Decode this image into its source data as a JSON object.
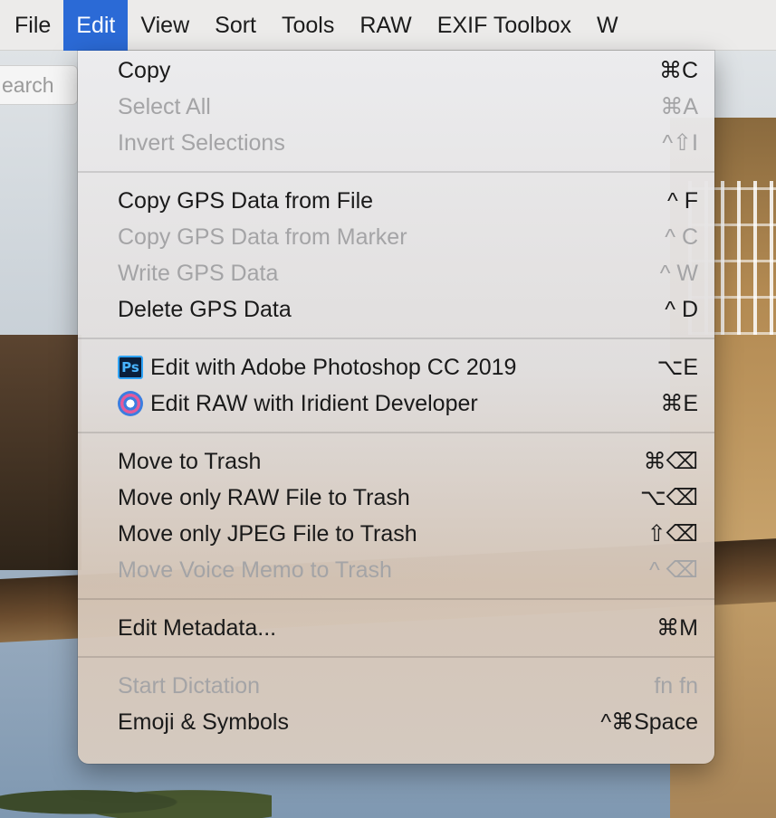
{
  "menubar": {
    "items": [
      {
        "label": "File"
      },
      {
        "label": "Edit",
        "active": true
      },
      {
        "label": "View"
      },
      {
        "label": "Sort"
      },
      {
        "label": "Tools"
      },
      {
        "label": "RAW"
      },
      {
        "label": "EXIF Toolbox"
      },
      {
        "label": "W"
      }
    ]
  },
  "search": {
    "text": "earch"
  },
  "menu": {
    "groups": [
      [
        {
          "label": "Copy",
          "shortcut": "⌘C",
          "enabled": true
        },
        {
          "label": "Select All",
          "shortcut": "⌘A",
          "enabled": false
        },
        {
          "label": "Invert Selections",
          "shortcut": "^⇧I",
          "enabled": false
        }
      ],
      [
        {
          "label": "Copy GPS Data from File",
          "shortcut": "^ F",
          "enabled": true
        },
        {
          "label": "Copy GPS Data from Marker",
          "shortcut": "^ C",
          "enabled": false
        },
        {
          "label": "Write GPS Data",
          "shortcut": "^ W",
          "enabled": false
        },
        {
          "label": "Delete GPS Data",
          "shortcut": "^ D",
          "enabled": true
        }
      ],
      [
        {
          "label": "Edit with Adobe Photoshop CC 2019",
          "shortcut": "⌥E",
          "enabled": true,
          "icon": "photoshop-icon",
          "icon_text": "Ps"
        },
        {
          "label": "Edit RAW with Iridient Developer",
          "shortcut": "⌘E",
          "enabled": true,
          "icon": "iridient-developer-icon"
        }
      ],
      [
        {
          "label": "Move to Trash",
          "shortcut": "⌘⌫",
          "enabled": true
        },
        {
          "label": "Move only RAW File to Trash",
          "shortcut": "⌥⌫",
          "enabled": true
        },
        {
          "label": "Move only JPEG File to Trash",
          "shortcut": "⇧⌫",
          "enabled": true
        },
        {
          "label": "Move Voice Memo to Trash",
          "shortcut": "^ ⌫",
          "enabled": false
        }
      ],
      [
        {
          "label": "Edit Metadata...",
          "shortcut": "⌘M",
          "enabled": true
        }
      ],
      [
        {
          "label": "Start Dictation",
          "shortcut": "fn fn",
          "enabled": false
        },
        {
          "label": "Emoji & Symbols",
          "shortcut": "^⌘Space",
          "enabled": true
        }
      ]
    ]
  },
  "colors": {
    "accent": "#2b6ad6",
    "enabled_text": "#1a1a1a",
    "disabled_text": "#a4a4a6"
  }
}
